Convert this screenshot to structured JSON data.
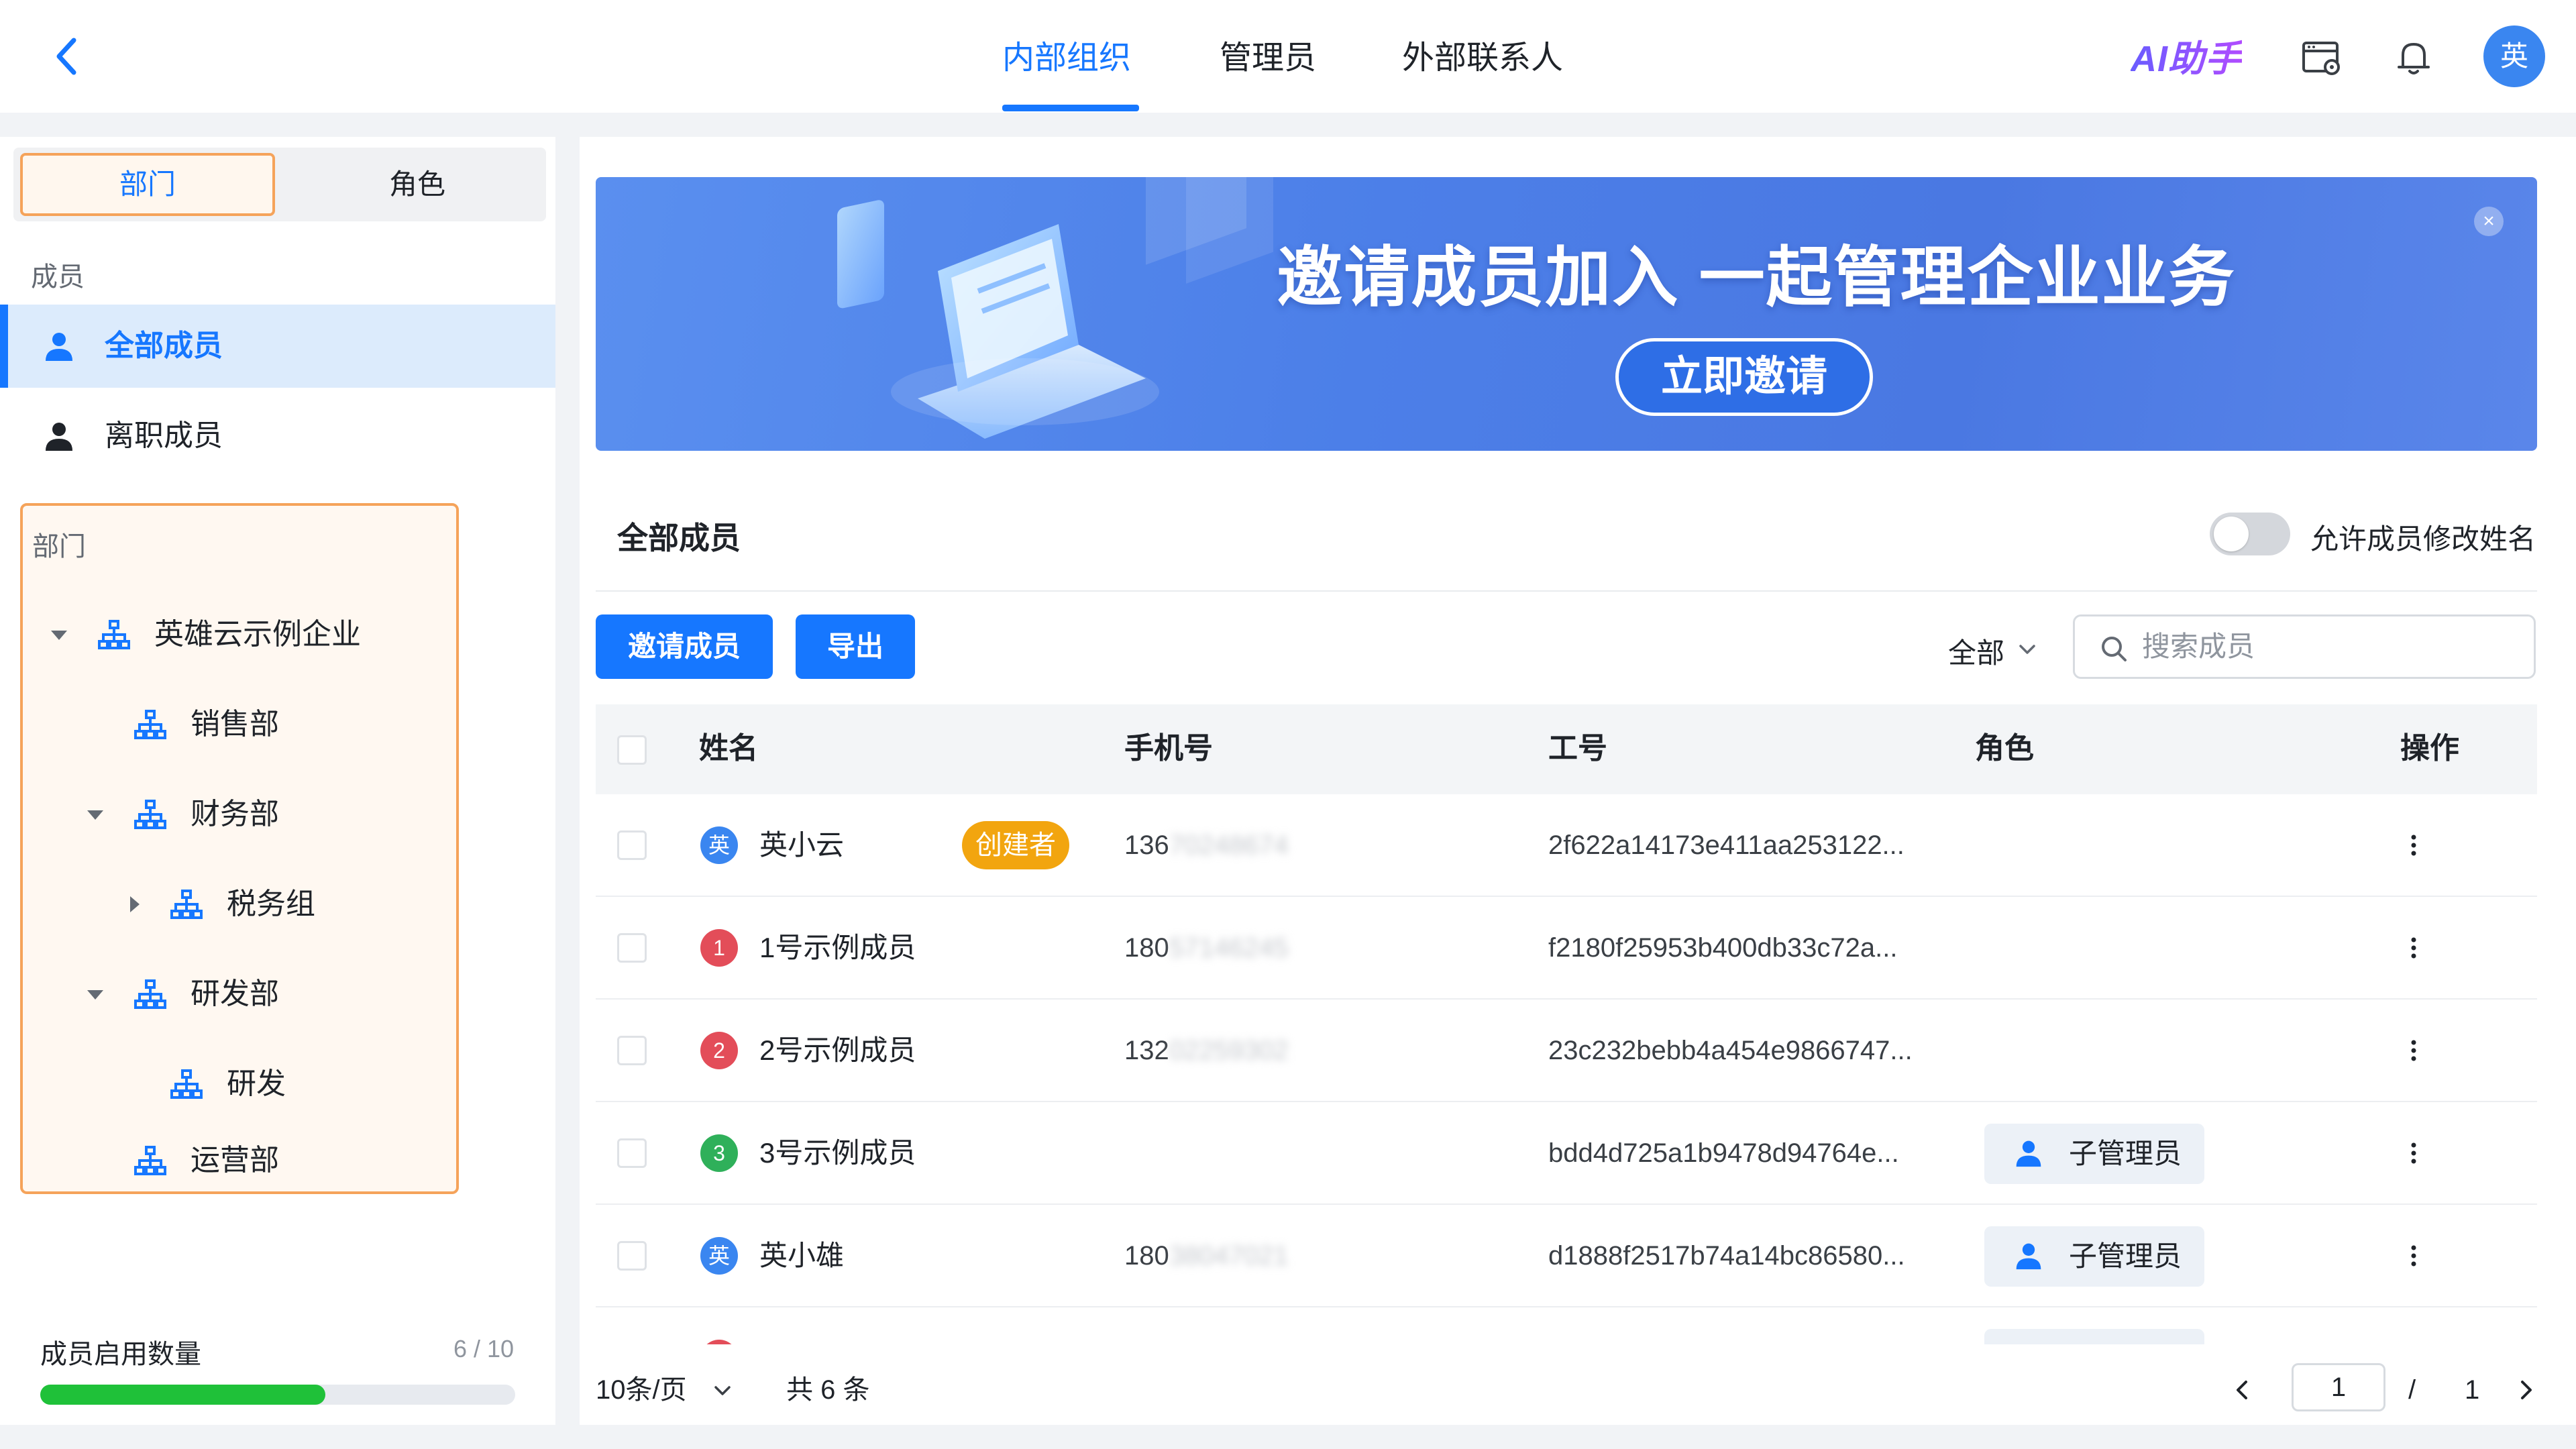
{
  "topbar": {
    "tabs": [
      {
        "label": "内部组织"
      },
      {
        "label": "管理员"
      },
      {
        "label": "外部联系人"
      }
    ],
    "ai_label": "AI助手",
    "avatar_text": "英",
    "colors": {
      "accent": "#1677ff"
    }
  },
  "sidebar": {
    "segments": [
      {
        "label": "部门"
      },
      {
        "label": "角色"
      }
    ],
    "members_caption": "成员",
    "member_items": [
      {
        "label": "全部成员"
      },
      {
        "label": "离职成员"
      }
    ],
    "dept_caption": "部门",
    "tree": [
      {
        "label": "英雄云示例企业",
        "expand": "expanded"
      },
      {
        "label": "销售部",
        "expand": "none"
      },
      {
        "label": "财务部",
        "expand": "expanded"
      },
      {
        "label": "税务组",
        "expand": "collapsed"
      },
      {
        "label": "研发部",
        "expand": "expanded"
      },
      {
        "label": "研发",
        "expand": "none"
      },
      {
        "label": "运营部",
        "expand": "none"
      }
    ],
    "quota": {
      "label": "成员启用数量",
      "count_text": "6 / 10",
      "used": 6,
      "total": 10
    }
  },
  "banner": {
    "title": "邀请成员加入 一起管理企业业务",
    "button_label": "立即邀请",
    "close_label": "×"
  },
  "main": {
    "section_title": "全部成员",
    "toggle_label": "允许成员修改姓名",
    "toggle_on": false,
    "invite_button": "邀请成员",
    "export_button": "导出",
    "filter_value": "全部",
    "search_placeholder": "搜索成员"
  },
  "table": {
    "headers": {
      "name": "姓名",
      "phone": "手机号",
      "job_no": "工号",
      "role": "角色",
      "action": "操作"
    },
    "rows": [
      {
        "avatar": "英",
        "avatar_color": "#3a86f0",
        "name": "英小云",
        "badge": "创建者",
        "phone_prefix": "136",
        "phone_masked": "70248674",
        "job_no": "2f622a14173e411aa253122...",
        "role": ""
      },
      {
        "avatar": "1",
        "avatar_color": "#e34d59",
        "name": "1号示例成员",
        "badge": "",
        "phone_prefix": "180",
        "phone_masked": "57146245",
        "job_no": "f2180f25953b400db33c72a...",
        "role": ""
      },
      {
        "avatar": "2",
        "avatar_color": "#e34d59",
        "name": "2号示例成员",
        "badge": "",
        "phone_prefix": "132",
        "phone_masked": "02259302",
        "job_no": "23c232bebb4a454e9866747...",
        "role": ""
      },
      {
        "avatar": "3",
        "avatar_color": "#2fb05a",
        "name": "3号示例成员",
        "badge": "",
        "phone_prefix": "",
        "phone_masked": "",
        "job_no": "bdd4d725a1b9478d94764e...",
        "role": "子管理员"
      },
      {
        "avatar": "英",
        "avatar_color": "#3a86f0",
        "name": "英小雄",
        "badge": "",
        "phone_prefix": "180",
        "phone_masked": "38047021",
        "job_no": "d1888f2517b74a14bc86580...",
        "role": "子管理员"
      }
    ]
  },
  "pagination": {
    "page_size": "10条/页",
    "total_text": "共 6 条",
    "current_page": "1",
    "separator": "/",
    "total_pages": "1"
  }
}
